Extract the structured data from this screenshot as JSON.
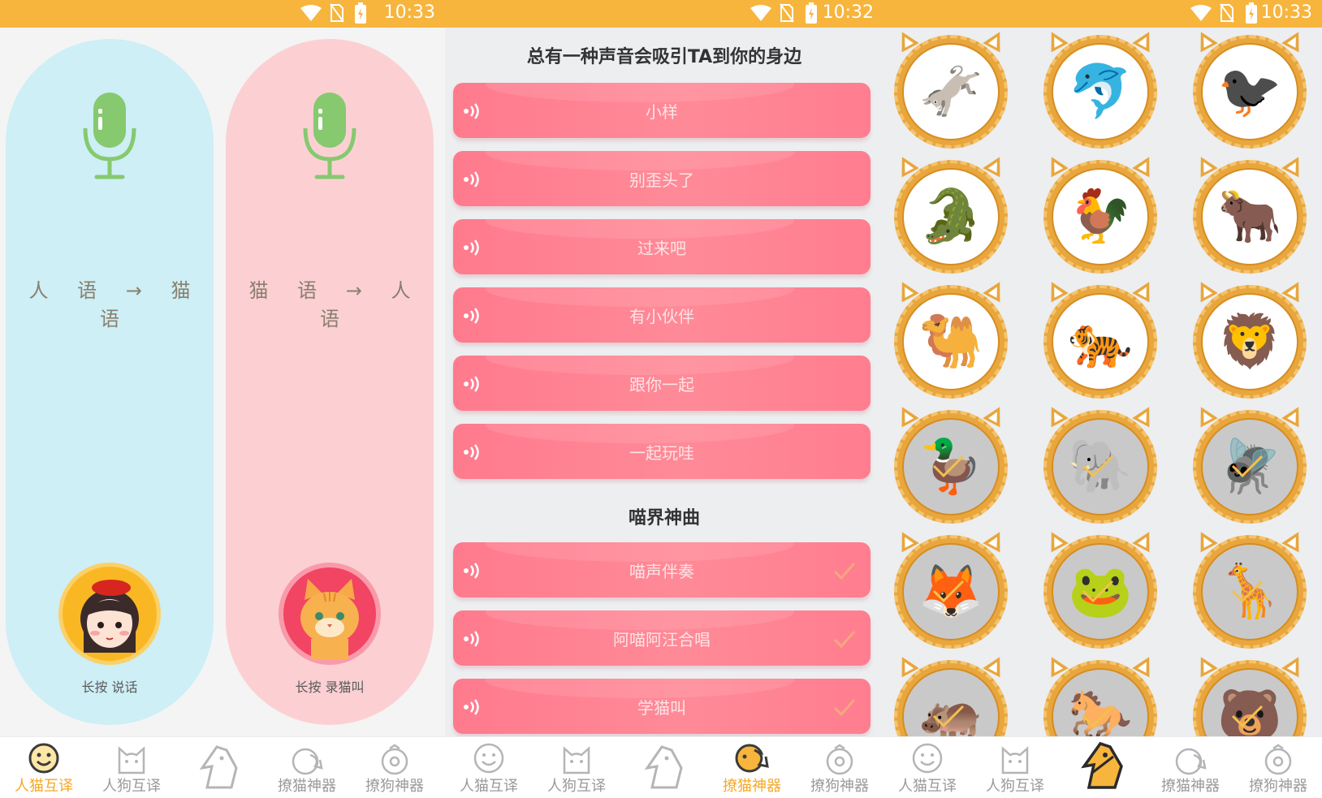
{
  "status_bar": {
    "times": [
      "10:33",
      "10:32",
      "10:33"
    ]
  },
  "translate": {
    "human_to_cat": "人 语 → 猫 语",
    "cat_to_human": "猫 语 → 人 语",
    "hold_speak": "长按 说话",
    "hold_record": "长按 录猫叫"
  },
  "tease": {
    "section1_title": "总有一种声音会吸引TA到你的身边",
    "sounds1": [
      {
        "label": "小样",
        "checked": false
      },
      {
        "label": "别歪头了",
        "checked": false
      },
      {
        "label": "过来吧",
        "checked": false
      },
      {
        "label": "有小伙伴",
        "checked": false
      },
      {
        "label": "跟你一起",
        "checked": false
      },
      {
        "label": "一起玩哇",
        "checked": false
      }
    ],
    "section2_title": "喵界神曲",
    "sounds2": [
      {
        "label": "喵声伴奏",
        "checked": true
      },
      {
        "label": "阿喵阿汪合唱",
        "checked": true
      },
      {
        "label": "学猫叫",
        "checked": true
      }
    ]
  },
  "animals": [
    {
      "icon": "donkey-icon",
      "selected": false
    },
    {
      "icon": "dolphin-icon",
      "selected": false
    },
    {
      "icon": "crow-icon",
      "selected": false
    },
    {
      "icon": "crocodile-icon",
      "selected": false
    },
    {
      "icon": "rooster-icon",
      "selected": false
    },
    {
      "icon": "cow-icon",
      "selected": false
    },
    {
      "icon": "camel-icon",
      "selected": false
    },
    {
      "icon": "tiger-icon",
      "selected": false
    },
    {
      "icon": "lion-icon",
      "selected": false
    },
    {
      "icon": "duck-icon",
      "selected": true
    },
    {
      "icon": "elephant-icon",
      "selected": true
    },
    {
      "icon": "fly-icon",
      "selected": true
    },
    {
      "icon": "fox-icon",
      "selected": true
    },
    {
      "icon": "frog-icon",
      "selected": true
    },
    {
      "icon": "giraffe-icon",
      "selected": true
    },
    {
      "icon": "hippo-icon",
      "selected": true
    },
    {
      "icon": "horse-icon",
      "selected": true
    },
    {
      "icon": "bear-icon",
      "selected": true
    }
  ],
  "tabs": {
    "labels": [
      "人猫互译",
      "人狗互译",
      "",
      "撩猫神器",
      "撩狗神器"
    ],
    "screen1_active": 0,
    "screen2_active": 3,
    "screen3_active": 2
  },
  "colors": {
    "accent": "#f7b53e",
    "active_tab": "#f7a824",
    "pill_blue": "#cdeff5",
    "pill_pink": "#fcd0d3",
    "sound_button": "#ff7a8d",
    "mic_green": "#86c96f"
  }
}
